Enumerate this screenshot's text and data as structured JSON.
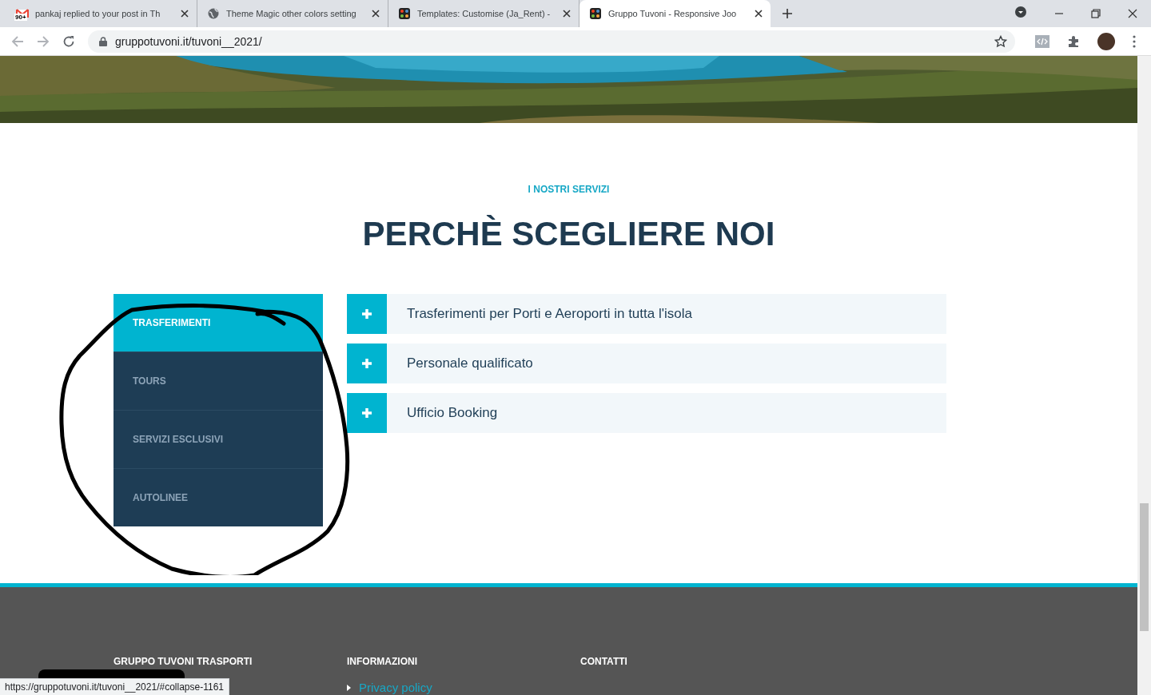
{
  "browser": {
    "tabs": [
      {
        "title": "pankaj replied to your post in Th",
        "badge": "90+",
        "selected": false
      },
      {
        "title": "Theme Magic other colors setting",
        "selected": false
      },
      {
        "title": "Templates: Customise (Ja_Rent) -",
        "selected": false
      },
      {
        "title": "Gruppo Tuvoni - Responsive Joo",
        "selected": true
      }
    ],
    "address": "gruppotuvoni.it/tuvoni__2021/"
  },
  "section": {
    "eyebrow": "I NOSTRI SERVIZI",
    "heading": "PERCHÈ SCEGLIERE NOI",
    "service_tabs": [
      {
        "label": "TRASFERIMENTI",
        "selected": true
      },
      {
        "label": "TOURS",
        "selected": false
      },
      {
        "label": "SERVIZI ESCLUSIVI",
        "selected": false
      },
      {
        "label": "AUTOLINEE",
        "selected": false
      }
    ],
    "accordion": [
      {
        "title": "Trasferimenti per Porti e Aeroporti in tutta l'isola",
        "expanded": false
      },
      {
        "title": "Personale qualificato",
        "expanded": false
      },
      {
        "title": "Ufficio Booking",
        "expanded": false
      }
    ]
  },
  "footer": {
    "columns": [
      {
        "heading": "GRUPPO TUVONI TRASPORTI"
      },
      {
        "heading": "INFORMAZIONI",
        "links": [
          "Privacy policy"
        ]
      },
      {
        "heading": "CONTATTI"
      }
    ]
  },
  "status_bar": {
    "url": "https://gruppotuvoni.it/tuvoni__2021/#collapse-1161"
  }
}
